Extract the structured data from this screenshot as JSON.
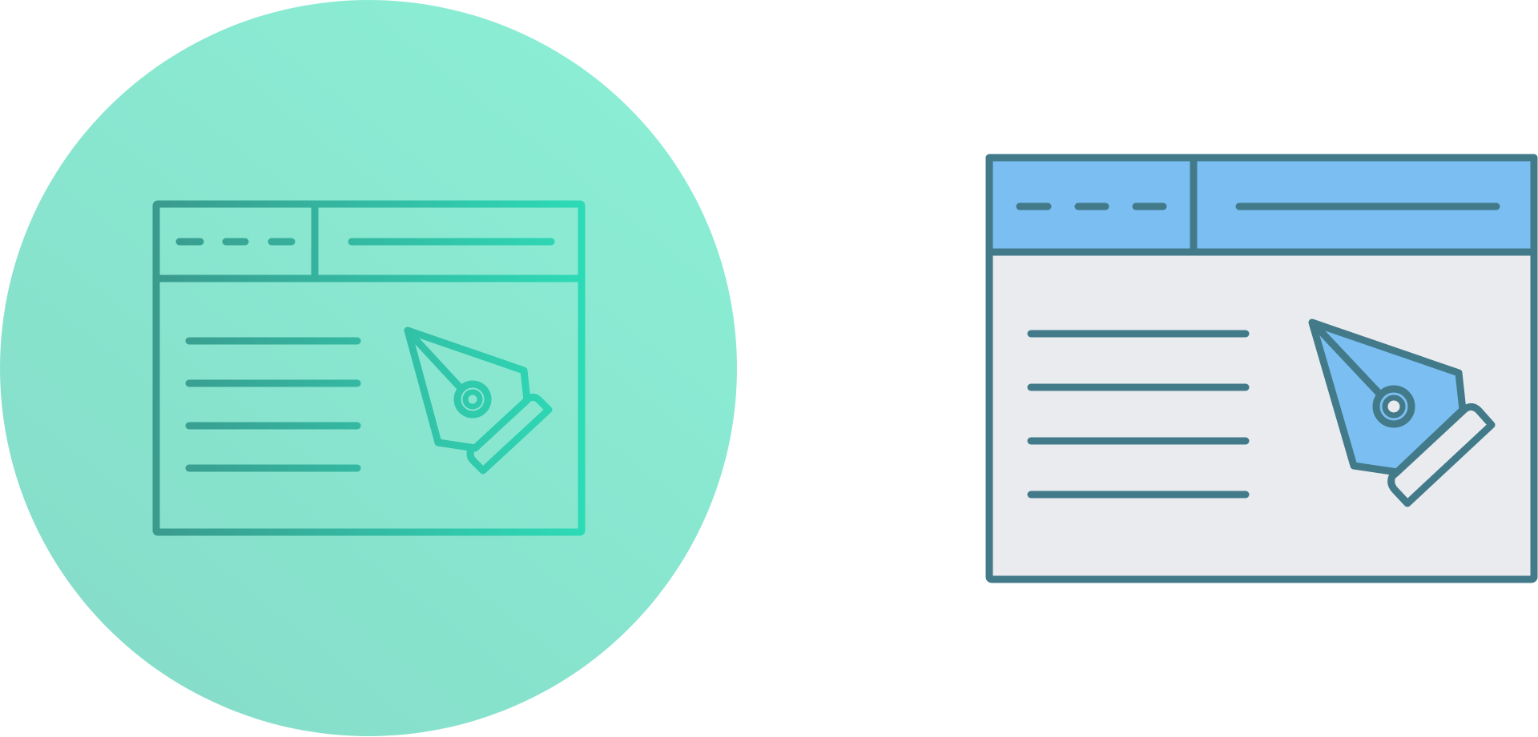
{
  "icons": [
    {
      "name": "web-design-icon",
      "style": "gradient-outline",
      "colors": {
        "circle_light": "#8CEFD6",
        "circle_dark": "#85DCC8",
        "stroke_start": "#3A9A8E",
        "stroke_end": "#2DDBB7"
      }
    },
    {
      "name": "web-design-icon",
      "style": "filled-color",
      "colors": {
        "stroke": "#427A8A",
        "header_fill": "#7BBEF2",
        "body_fill": "#E9EBEF",
        "pen_fill": "#7BBEF2"
      }
    }
  ]
}
